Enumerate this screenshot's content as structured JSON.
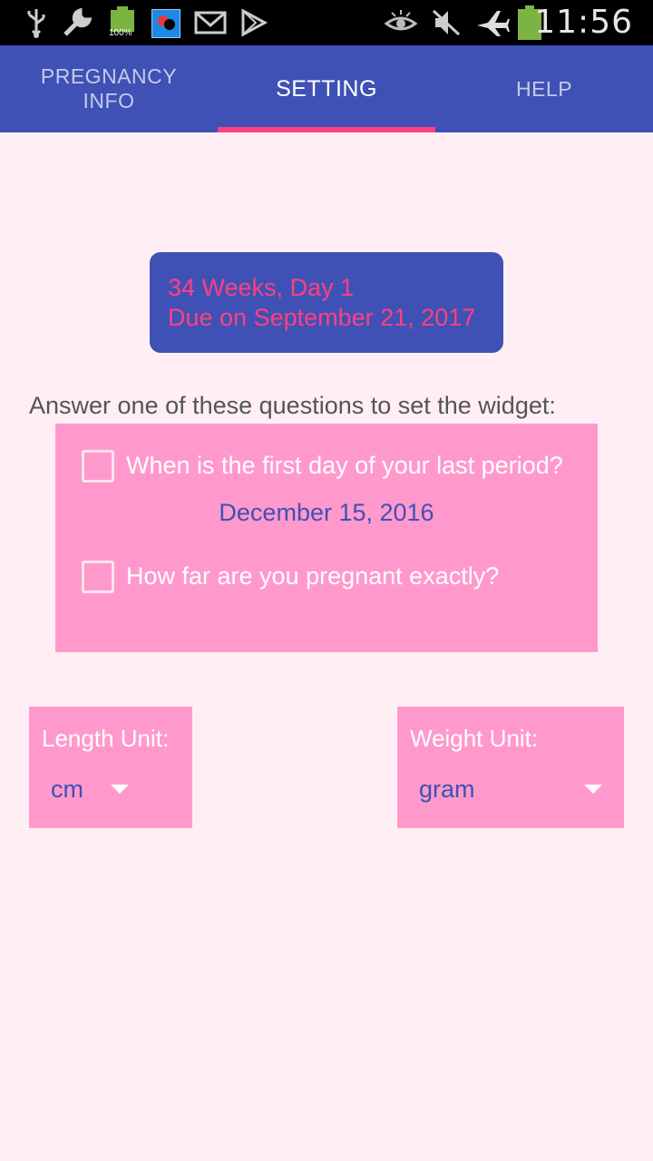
{
  "status_bar": {
    "battery_small_label": "100%",
    "time": "11:56",
    "icons": [
      "usb-icon",
      "wrench-icon",
      "battery-full-icon",
      "app-notification-icon",
      "gmail-icon",
      "play-store-icon",
      "eye-icon",
      "mute-icon",
      "airplane-mode-icon",
      "battery-icon"
    ]
  },
  "tabs": [
    {
      "label": "PREGNANCY\nINFO",
      "active": false
    },
    {
      "label": "SETTING",
      "active": true
    },
    {
      "label": "HELP",
      "active": false
    }
  ],
  "due_info": {
    "weeks": "34 Weeks, Day 1",
    "due_date": "Due on September 21, 2017"
  },
  "instruction": "Answer one of these questions to set the widget:",
  "questions": {
    "last_period": {
      "label": "When is the first day of your last period?",
      "checked": false,
      "value": "December 15, 2016"
    },
    "how_far": {
      "label": "How far are you pregnant exactly?",
      "checked": false
    }
  },
  "units": {
    "length": {
      "label": "Length Unit:",
      "value": "cm"
    },
    "weight": {
      "label": "Weight Unit:",
      "value": "gram"
    }
  },
  "colors": {
    "primary": "#3F51B5",
    "accent": "#FF4081",
    "panel": "#FF99CC",
    "background": "#FFEFF4"
  }
}
